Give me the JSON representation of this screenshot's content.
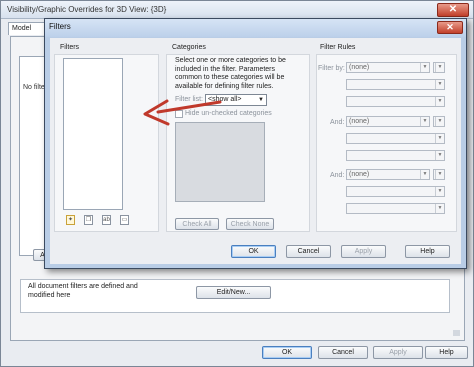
{
  "background_window": {
    "title": "Visibility/Graphic Overrides for 3D View: {3D}",
    "close_glyph": "✕",
    "tab_label": "Model Cate",
    "no_filters_text": "No filte",
    "a_button": "A",
    "info_text": "All document filters are defined and modified here",
    "edit_new_button": "Edit/New...",
    "buttons": {
      "ok": "OK",
      "cancel": "Cancel",
      "apply": "Apply",
      "help": "Help"
    }
  },
  "filters_dialog": {
    "title": "Filters",
    "close_glyph": "✕",
    "filters_header": "Filters",
    "toolbar_icons": [
      "new-filter-icon",
      "duplicate-filter-icon",
      "rename-filter-icon",
      "delete-filter-icon"
    ],
    "categories": {
      "header": "Categories",
      "description": "Select one or more categories to be included in the filter. Parameters common to these categories will be available for defining filter rules.",
      "filter_list_label": "Filter list:",
      "filter_list_value": "<show all>",
      "hide_unchecked_label": "Hide un-checked categories",
      "check_all_button": "Check All",
      "check_none_button": "Check None"
    },
    "filter_rules": {
      "header": "Filter Rules",
      "filter_by_label": "Filter by:",
      "filter_by_value": "(none)",
      "and_label": "And:",
      "and_value": "(none)"
    },
    "buttons": {
      "ok": "OK",
      "cancel": "Cancel",
      "apply": "Apply",
      "help": "Help"
    }
  },
  "colors": {
    "accent_arrow": "#c0392b",
    "title_bar": "#bcd0ea"
  }
}
